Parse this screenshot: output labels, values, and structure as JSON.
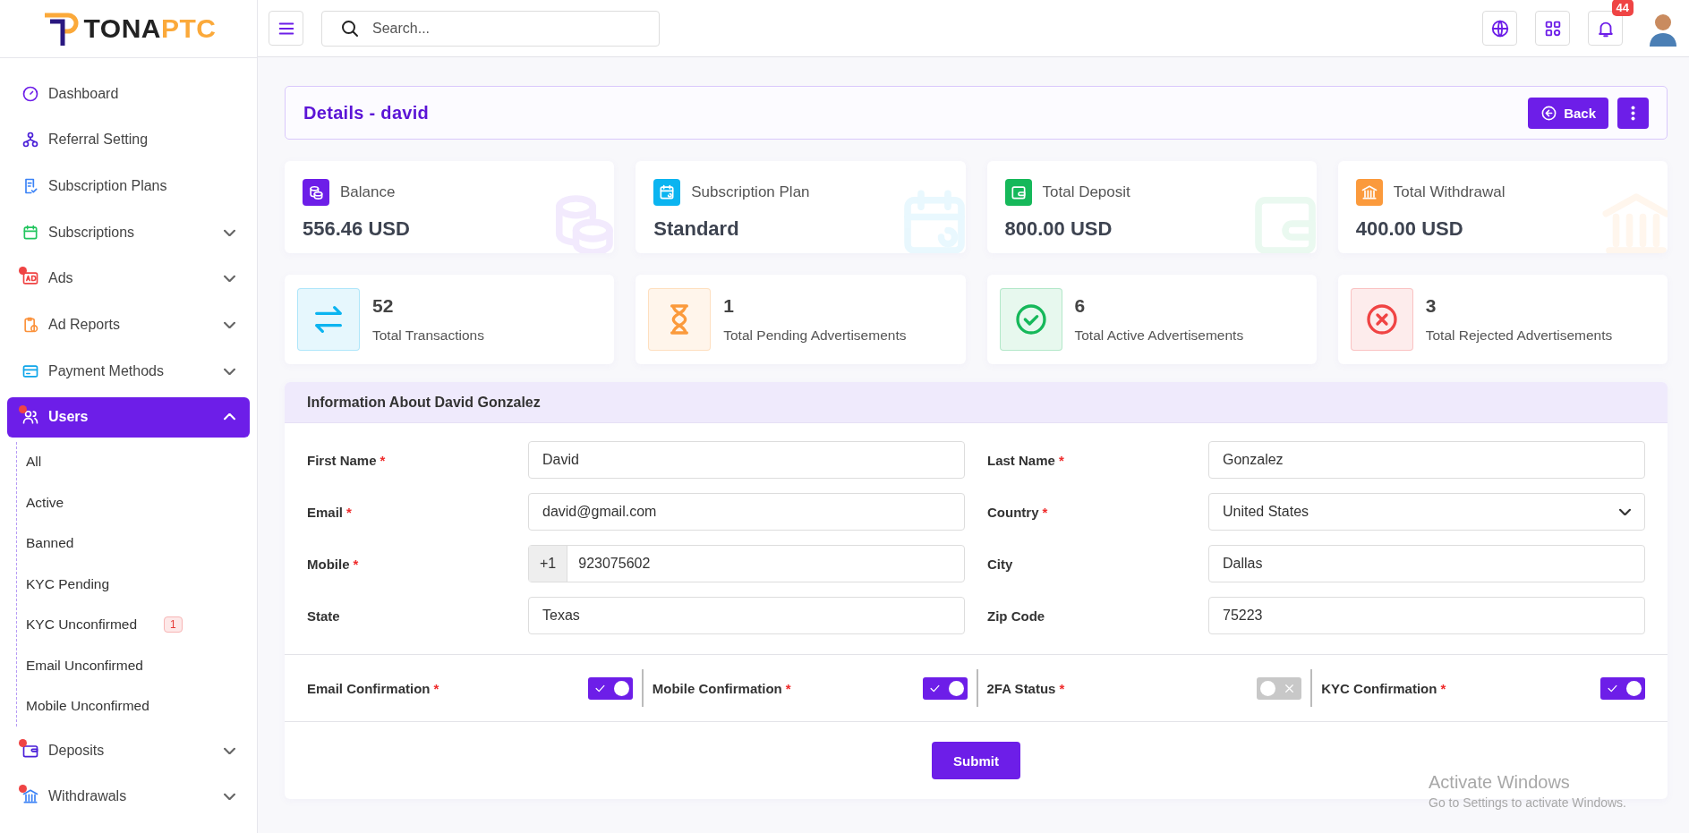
{
  "logo": {
    "prefix": "TONA",
    "suffix": "PTC"
  },
  "sidebar": {
    "items": [
      {
        "label": "Dashboard",
        "selected": false,
        "alert": false
      },
      {
        "label": "Referral Setting",
        "selected": false,
        "alert": false
      },
      {
        "label": "Subscription Plans",
        "selected": false,
        "alert": false
      },
      {
        "label": "Subscriptions",
        "has_submenu": true,
        "expanded": false,
        "selected": false,
        "alert": false
      },
      {
        "label": "Ads",
        "has_submenu": true,
        "expanded": false,
        "selected": false,
        "alert": true
      },
      {
        "label": "Ad Reports",
        "has_submenu": true,
        "expanded": false,
        "selected": false,
        "alert": false
      },
      {
        "label": "Payment Methods",
        "has_submenu": true,
        "expanded": false,
        "selected": false,
        "alert": false
      },
      {
        "label": "Users",
        "has_submenu": true,
        "expanded": true,
        "selected": true,
        "alert": true,
        "children": [
          {
            "label": "All"
          },
          {
            "label": "Active"
          },
          {
            "label": "Banned"
          },
          {
            "label": "KYC Pending"
          },
          {
            "label": "KYC Unconfirmed",
            "badge": "1"
          },
          {
            "label": "Email Unconfirmed"
          },
          {
            "label": "Mobile Unconfirmed"
          }
        ]
      },
      {
        "label": "Deposits",
        "has_submenu": true,
        "expanded": false,
        "selected": false,
        "alert": true
      },
      {
        "label": "Withdrawals",
        "has_submenu": true,
        "expanded": false,
        "selected": false,
        "alert": true
      }
    ]
  },
  "header": {
    "search": {
      "placeholder": "Search..."
    },
    "notification_count": "44"
  },
  "page": {
    "title": "Details - david",
    "back_button": "Back"
  },
  "stats": [
    {
      "label": "Balance",
      "value": "556.46 USD",
      "color": "#6d1ee8"
    },
    {
      "label": "Subscription Plan",
      "value": "Standard",
      "color": "#0bb4f0"
    },
    {
      "label": "Total Deposit",
      "value": "800.00 USD",
      "color": "#16b85a"
    },
    {
      "label": "Total Withdrawal",
      "value": "400.00 USD",
      "color": "#fb9a3c"
    }
  ],
  "counts": [
    {
      "value": "52",
      "label": "Total Transactions",
      "color": "#0bb4f0"
    },
    {
      "value": "1",
      "label": "Total Pending Advertisements",
      "color": "#fb9a3c"
    },
    {
      "value": "6",
      "label": "Total Active Advertisements",
      "color": "#16b85a"
    },
    {
      "value": "3",
      "label": "Total Rejected Advertisements",
      "color": "#f04444"
    }
  ],
  "info": {
    "title": "Information About David Gonzalez",
    "fields": [
      {
        "label": "First Name",
        "required_mark": "*",
        "kind": "text",
        "value": "David"
      },
      {
        "label": "Last Name",
        "required_mark": "*",
        "kind": "text",
        "value": "Gonzalez"
      },
      {
        "label": "Email",
        "required_mark": "*",
        "kind": "text",
        "value": "david@gmail.com"
      },
      {
        "label": "Country",
        "required_mark": "*",
        "kind": "select",
        "value": "United States"
      },
      {
        "label": "Mobile",
        "required_mark": "*",
        "kind": "phone",
        "prefix": "+1",
        "value": "923075602"
      },
      {
        "label": "City",
        "kind": "text",
        "value": "Dallas"
      },
      {
        "label": "State",
        "kind": "text",
        "value": "Texas"
      },
      {
        "label": "Zip Code",
        "kind": "text",
        "value": "75223"
      }
    ],
    "toggles": [
      {
        "label": "Email Confirmation",
        "required_mark": "*",
        "on": true
      },
      {
        "label": "Mobile Confirmation",
        "required_mark": "*",
        "on": true
      },
      {
        "label": "2FA Status",
        "required_mark": "*",
        "on": false
      },
      {
        "label": "KYC Confirmation",
        "required_mark": "*",
        "on": true
      }
    ],
    "submit_button": "Submit"
  },
  "os_notice": {
    "title": "Activate Windows",
    "subtitle": "Go to Settings to activate Windows."
  }
}
